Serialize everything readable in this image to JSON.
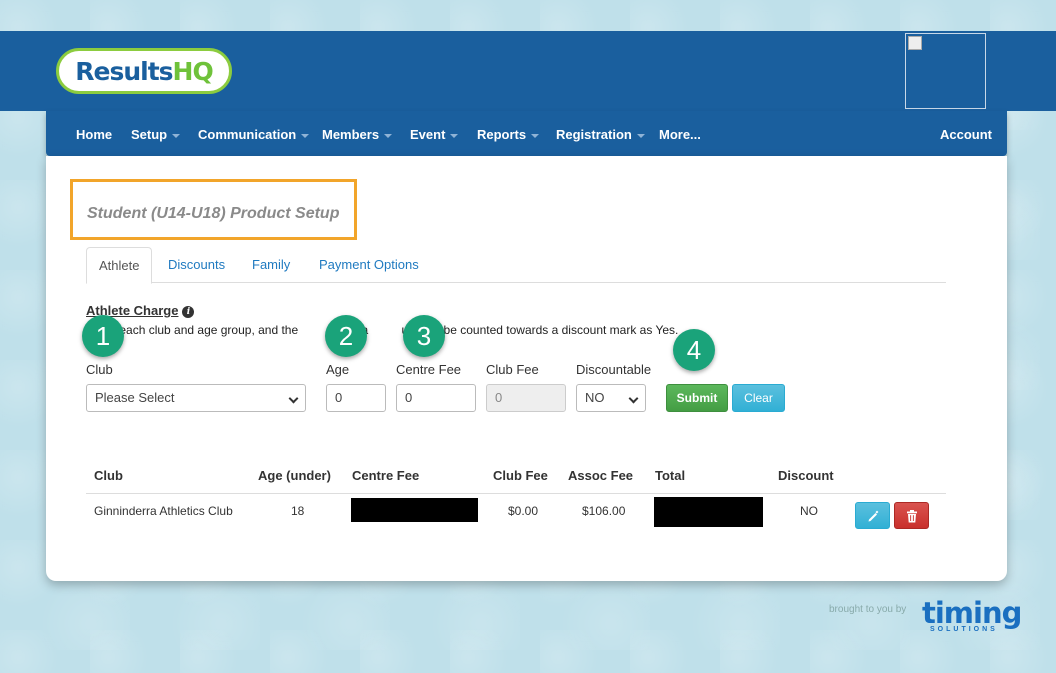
{
  "brand": {
    "logo_part1": "Results",
    "logo_part2": "HQ"
  },
  "nav": {
    "items": [
      {
        "label": "Home",
        "dropdown": false
      },
      {
        "label": "Setup",
        "dropdown": true
      },
      {
        "label": "Communication",
        "dropdown": true
      },
      {
        "label": "Members",
        "dropdown": true
      },
      {
        "label": "Event",
        "dropdown": true
      },
      {
        "label": "Reports",
        "dropdown": true
      },
      {
        "label": "Registration",
        "dropdown": true
      },
      {
        "label": "More...",
        "dropdown": false
      }
    ],
    "account": "Account"
  },
  "page": {
    "title": "Student (U14-U18) Product Setup"
  },
  "tabs": [
    {
      "label": "Athlete",
      "active": true
    },
    {
      "label": "Discounts",
      "active": false
    },
    {
      "label": "Family",
      "active": false
    },
    {
      "label": "Payment Options",
      "active": false
    }
  ],
  "section": {
    "heading": "Athlete Charge",
    "instruction": "      of each club and age group, and the           If an a          up is to be counted towards a discount mark as Yes."
  },
  "steps": [
    "1",
    "2",
    "3",
    "4"
  ],
  "form": {
    "club_label": "Club",
    "club_value": "Please Select",
    "age_label": "Age",
    "age_value": "0",
    "centre_fee_label": "Centre Fee",
    "centre_fee_value": "0",
    "club_fee_label": "Club Fee",
    "club_fee_value": "0",
    "discountable_label": "Discountable",
    "discountable_value": "NO",
    "submit_label": "Submit",
    "clear_label": "Clear"
  },
  "table": {
    "headers": [
      "Club",
      "Age (under)",
      "Centre Fee",
      "Club Fee",
      "Assoc Fee",
      "Total",
      "Discount"
    ],
    "rows": [
      {
        "club": "Ginninderra Athletics Club",
        "age": "18",
        "club_fee": "$0.00",
        "assoc_fee": "$106.00",
        "discount": "NO"
      }
    ]
  },
  "footer": {
    "brought_by": "brought to you by",
    "timing": "timing",
    "solutions": "SOLUTIONS"
  },
  "colors": {
    "header_blue": "#1a5f9e",
    "accent_green": "#1aa37a",
    "highlight_orange": "#f2a52a",
    "background": "#bfe0ea"
  }
}
